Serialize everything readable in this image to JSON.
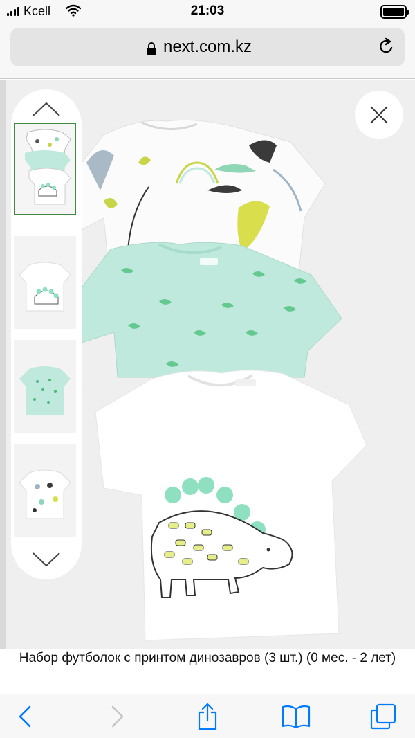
{
  "status_bar": {
    "carrier": "Kcell",
    "time": "21:03"
  },
  "browser": {
    "url": "next.com.kz"
  },
  "product": {
    "title": "Набор футболок с принтом динозавров (3 шт.) (0 мес. - 2 лет)"
  },
  "gallery": {
    "thumbnail_count": 4,
    "selected_index": 0
  },
  "colors": {
    "mint": "#bfe9dc",
    "dino_green": "#63c98f",
    "lime": "#c9d64a",
    "accent": "#007aff",
    "selected_border": "#3f8a3f"
  }
}
